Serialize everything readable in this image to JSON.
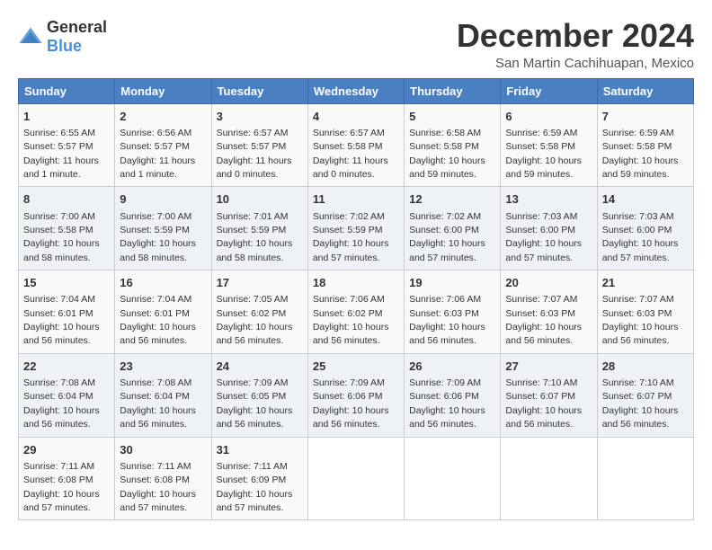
{
  "header": {
    "logo_general": "General",
    "logo_blue": "Blue",
    "title": "December 2024",
    "subtitle": "San Martin Cachihuapan, Mexico"
  },
  "calendar": {
    "days_of_week": [
      "Sunday",
      "Monday",
      "Tuesday",
      "Wednesday",
      "Thursday",
      "Friday",
      "Saturday"
    ],
    "weeks": [
      [
        null,
        null,
        null,
        null,
        null,
        null,
        null
      ],
      [
        null,
        null,
        null,
        null,
        null,
        null,
        null
      ],
      [
        null,
        null,
        null,
        null,
        null,
        null,
        null
      ],
      [
        null,
        null,
        null,
        null,
        null,
        null,
        null
      ],
      [
        null,
        null,
        null,
        null,
        null,
        null,
        null
      ],
      [
        null,
        null,
        null,
        null,
        null,
        null,
        null
      ]
    ],
    "cells": [
      {
        "day": 1,
        "dow": 0,
        "week": 0,
        "sunrise": "6:55 AM",
        "sunset": "5:57 PM",
        "daylight": "11 hours and 1 minute."
      },
      {
        "day": 2,
        "dow": 1,
        "week": 0,
        "sunrise": "6:56 AM",
        "sunset": "5:57 PM",
        "daylight": "11 hours and 1 minute."
      },
      {
        "day": 3,
        "dow": 2,
        "week": 0,
        "sunrise": "6:57 AM",
        "sunset": "5:57 PM",
        "daylight": "11 hours and 0 minutes."
      },
      {
        "day": 4,
        "dow": 3,
        "week": 0,
        "sunrise": "6:57 AM",
        "sunset": "5:58 PM",
        "daylight": "11 hours and 0 minutes."
      },
      {
        "day": 5,
        "dow": 4,
        "week": 0,
        "sunrise": "6:58 AM",
        "sunset": "5:58 PM",
        "daylight": "10 hours and 59 minutes."
      },
      {
        "day": 6,
        "dow": 5,
        "week": 0,
        "sunrise": "6:59 AM",
        "sunset": "5:58 PM",
        "daylight": "10 hours and 59 minutes."
      },
      {
        "day": 7,
        "dow": 6,
        "week": 0,
        "sunrise": "6:59 AM",
        "sunset": "5:58 PM",
        "daylight": "10 hours and 59 minutes."
      },
      {
        "day": 8,
        "dow": 0,
        "week": 1,
        "sunrise": "7:00 AM",
        "sunset": "5:58 PM",
        "daylight": "10 hours and 58 minutes."
      },
      {
        "day": 9,
        "dow": 1,
        "week": 1,
        "sunrise": "7:00 AM",
        "sunset": "5:59 PM",
        "daylight": "10 hours and 58 minutes."
      },
      {
        "day": 10,
        "dow": 2,
        "week": 1,
        "sunrise": "7:01 AM",
        "sunset": "5:59 PM",
        "daylight": "10 hours and 58 minutes."
      },
      {
        "day": 11,
        "dow": 3,
        "week": 1,
        "sunrise": "7:02 AM",
        "sunset": "5:59 PM",
        "daylight": "10 hours and 57 minutes."
      },
      {
        "day": 12,
        "dow": 4,
        "week": 1,
        "sunrise": "7:02 AM",
        "sunset": "6:00 PM",
        "daylight": "10 hours and 57 minutes."
      },
      {
        "day": 13,
        "dow": 5,
        "week": 1,
        "sunrise": "7:03 AM",
        "sunset": "6:00 PM",
        "daylight": "10 hours and 57 minutes."
      },
      {
        "day": 14,
        "dow": 6,
        "week": 1,
        "sunrise": "7:03 AM",
        "sunset": "6:00 PM",
        "daylight": "10 hours and 57 minutes."
      },
      {
        "day": 15,
        "dow": 0,
        "week": 2,
        "sunrise": "7:04 AM",
        "sunset": "6:01 PM",
        "daylight": "10 hours and 56 minutes."
      },
      {
        "day": 16,
        "dow": 1,
        "week": 2,
        "sunrise": "7:04 AM",
        "sunset": "6:01 PM",
        "daylight": "10 hours and 56 minutes."
      },
      {
        "day": 17,
        "dow": 2,
        "week": 2,
        "sunrise": "7:05 AM",
        "sunset": "6:02 PM",
        "daylight": "10 hours and 56 minutes."
      },
      {
        "day": 18,
        "dow": 3,
        "week": 2,
        "sunrise": "7:06 AM",
        "sunset": "6:02 PM",
        "daylight": "10 hours and 56 minutes."
      },
      {
        "day": 19,
        "dow": 4,
        "week": 2,
        "sunrise": "7:06 AM",
        "sunset": "6:03 PM",
        "daylight": "10 hours and 56 minutes."
      },
      {
        "day": 20,
        "dow": 5,
        "week": 2,
        "sunrise": "7:07 AM",
        "sunset": "6:03 PM",
        "daylight": "10 hours and 56 minutes."
      },
      {
        "day": 21,
        "dow": 6,
        "week": 2,
        "sunrise": "7:07 AM",
        "sunset": "6:03 PM",
        "daylight": "10 hours and 56 minutes."
      },
      {
        "day": 22,
        "dow": 0,
        "week": 3,
        "sunrise": "7:08 AM",
        "sunset": "6:04 PM",
        "daylight": "10 hours and 56 minutes."
      },
      {
        "day": 23,
        "dow": 1,
        "week": 3,
        "sunrise": "7:08 AM",
        "sunset": "6:04 PM",
        "daylight": "10 hours and 56 minutes."
      },
      {
        "day": 24,
        "dow": 2,
        "week": 3,
        "sunrise": "7:09 AM",
        "sunset": "6:05 PM",
        "daylight": "10 hours and 56 minutes."
      },
      {
        "day": 25,
        "dow": 3,
        "week": 3,
        "sunrise": "7:09 AM",
        "sunset": "6:06 PM",
        "daylight": "10 hours and 56 minutes."
      },
      {
        "day": 26,
        "dow": 4,
        "week": 3,
        "sunrise": "7:09 AM",
        "sunset": "6:06 PM",
        "daylight": "10 hours and 56 minutes."
      },
      {
        "day": 27,
        "dow": 5,
        "week": 3,
        "sunrise": "7:10 AM",
        "sunset": "6:07 PM",
        "daylight": "10 hours and 56 minutes."
      },
      {
        "day": 28,
        "dow": 6,
        "week": 3,
        "sunrise": "7:10 AM",
        "sunset": "6:07 PM",
        "daylight": "10 hours and 56 minutes."
      },
      {
        "day": 29,
        "dow": 0,
        "week": 4,
        "sunrise": "7:11 AM",
        "sunset": "6:08 PM",
        "daylight": "10 hours and 57 minutes."
      },
      {
        "day": 30,
        "dow": 1,
        "week": 4,
        "sunrise": "7:11 AM",
        "sunset": "6:08 PM",
        "daylight": "10 hours and 57 minutes."
      },
      {
        "day": 31,
        "dow": 2,
        "week": 4,
        "sunrise": "7:11 AM",
        "sunset": "6:09 PM",
        "daylight": "10 hours and 57 minutes."
      }
    ]
  }
}
